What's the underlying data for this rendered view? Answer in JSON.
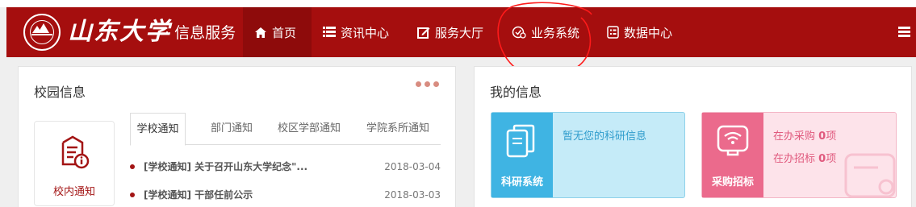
{
  "header": {
    "logo_text": "山东大学",
    "site_title": "· 信息服务",
    "nav": [
      {
        "label": "首页",
        "icon": "home-icon",
        "active": true
      },
      {
        "label": "资讯中心",
        "icon": "list-icon"
      },
      {
        "label": "服务大厅",
        "icon": "edit-icon"
      },
      {
        "label": "业务系统",
        "icon": "gear-check-icon"
      },
      {
        "label": "数据中心",
        "icon": "data-icon"
      }
    ],
    "menu_icon": "hamburger-menu-icon"
  },
  "campus": {
    "title": "校园信息",
    "notice_label": "校内通知",
    "tabs": [
      "学校通知",
      "部门通知",
      "校区学部通知",
      "学院系所通知"
    ],
    "news": [
      {
        "title": "[学校通知] 关于召开山东大学纪念\"...",
        "date": "2018-03-04"
      },
      {
        "title": "[学校通知] 干部任前公示",
        "date": "2018-03-03"
      }
    ]
  },
  "mine": {
    "title": "我的信息",
    "research": {
      "label": "科研系统",
      "message": "暂无您的科研信息"
    },
    "purchase": {
      "label": "采购招标",
      "lines": [
        {
          "prefix": "在办采购",
          "count": "0",
          "suffix": "项"
        },
        {
          "prefix": "在办招标",
          "count": "0",
          "suffix": "项"
        }
      ]
    }
  },
  "colors": {
    "brand": "#a50e0e",
    "accent": "#a31515",
    "blue": "#3fb4e3",
    "pink": "#eb6a8c"
  }
}
